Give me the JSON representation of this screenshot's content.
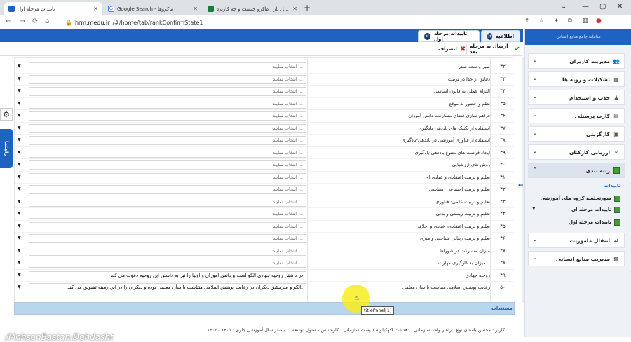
{
  "browser": {
    "tabs": [
      {
        "title": "تاییدات مرحله اول",
        "color": "#1f63c2"
      },
      {
        "title": "Google Search - ماکروها",
        "color": "#4285f4"
      },
      {
        "title": "اکسل باز | ماکرو چیست و چه کاربرد...",
        "color": "#1d7a3a"
      }
    ],
    "url_host": "hrm.medu.ir",
    "url_path": "/#/home/tab/rankConfirmState1"
  },
  "app": {
    "sidebar_title": "سامانه جامع منابع انسانی",
    "tabs": [
      {
        "label": "اطلاعیه"
      },
      {
        "label": "تاییدات مرحله اول"
      }
    ],
    "actions": {
      "send_next": "ارسال به مرحله بعد",
      "cancel": "انصراف"
    },
    "dropdown_placeholder": "انتخاب نمایید ...",
    "rows": [
      {
        "num": "۳۲",
        "crit": "صبر و سعه صدر",
        "value": ""
      },
      {
        "num": "۳۳",
        "crit": "دقائق از خدا در تربیت",
        "value": ""
      },
      {
        "num": "۳۴",
        "crit": "التزام عملی به قانون اساسی",
        "value": ""
      },
      {
        "num": "۳۵",
        "crit": "نظم و حضور به موقع",
        "value": ""
      },
      {
        "num": "۳۶",
        "crit": "فراهم سازی فضای مشارکت دانش آموزان",
        "value": ""
      },
      {
        "num": "۳۷",
        "crit": "استفاده از تکنیک های یاددهی-یادگیری",
        "value": ""
      },
      {
        "num": "۳۸",
        "crit": "استفاده از فناوری آموزشی در یاددهی-یادگیری",
        "value": ""
      },
      {
        "num": "۳۹",
        "crit": "ایجاد فرصت های متنوع یاددهی-یادگیری",
        "value": ""
      },
      {
        "num": "۴۰",
        "crit": "روش های ارزشیابی",
        "value": ""
      },
      {
        "num": "۴۱",
        "crit": "تعلیم و تربیت اعتقادی و عبادی ای",
        "value": ""
      },
      {
        "num": "۴۲",
        "crit": "تعلیم و تربیت اجتماعی- سیاسی",
        "value": ""
      },
      {
        "num": "۴۳",
        "crit": "تعلیم و تربیت علمی- فناوری",
        "value": ""
      },
      {
        "num": "۴۴",
        "crit": "تعلیم و تربیت زیستی و بدنی",
        "value": ""
      },
      {
        "num": "۴۵",
        "crit": "تعلیم و تربیت اعتقادی، عبادی و اخلاقی",
        "value": ""
      },
      {
        "num": "۴۶",
        "crit": "تعلیم و تربیت زیبایی شناختی و هنری",
        "value": ""
      },
      {
        "num": "۴۷",
        "crit": "میزان مشارکت در شوراها",
        "value": ""
      },
      {
        "num": "۴۸",
        "crit": "میزان به کارگیری مهارت...",
        "value": ""
      },
      {
        "num": "۴۹",
        "crit": "روحیه جهادی",
        "value": "در داشتن روحیه جهادی الگو است و دانش آموزان و اولیا را نیز به داشتن این روحیه دعوت می کند"
      },
      {
        "num": "۵۰",
        "crit": "رعایت پوشش اسلامی متناسب با شأن معلمی",
        "value": "الگو و سرمشق دیگران در رعایت پوشش اسلامی متناسب با شأن معلمی بوده و دیگران را در این زمینه تشویق می کند."
      }
    ],
    "tooltip": "titlePanel[1]",
    "documents_label": "مستندات",
    "watermark": "/MohsenBastan.Dehdasht",
    "footer": "کاربر : محسن باستان   نوع : راهبر   واحد سازمانی : دهدشت اکهکیلویه ۱   پست سازمانی : کارشناس مسئول توسعه ...   بیشتر   سال آموزشی جاری : ۱۴۰۱ - ۱۴۰۲",
    "help_label": "راهنما",
    "sidebar": [
      {
        "label": "مدیریت کاربران",
        "icon": "users-icon"
      },
      {
        "label": "تشکیلات و رویه ها",
        "icon": "org-chart-icon"
      },
      {
        "label": "جذب و استخدام",
        "icon": "recruit-icon"
      },
      {
        "label": "کارت پرسنلی",
        "icon": "id-card-icon"
      },
      {
        "label": "کارگزینی",
        "icon": "folder-icon"
      },
      {
        "label": "ارزیابی کارکنان",
        "icon": "magnifier-icon"
      },
      {
        "label": "رتبه بندی",
        "icon": "ranking-icon"
      }
    ],
    "sidebar_sub": [
      {
        "label": "تاییدات"
      },
      {
        "label": "صورتجلسه گروه های آموزشی"
      },
      {
        "label": "تاییدات مرحله ای"
      },
      {
        "label": "تاییدات مرحله اول"
      }
    ],
    "sidebar_bottom": [
      {
        "label": "انتقال ماموریت",
        "icon": "transfer-icon"
      },
      {
        "label": "مدیریت منابع انسانی",
        "icon": "hr-icon"
      }
    ]
  }
}
